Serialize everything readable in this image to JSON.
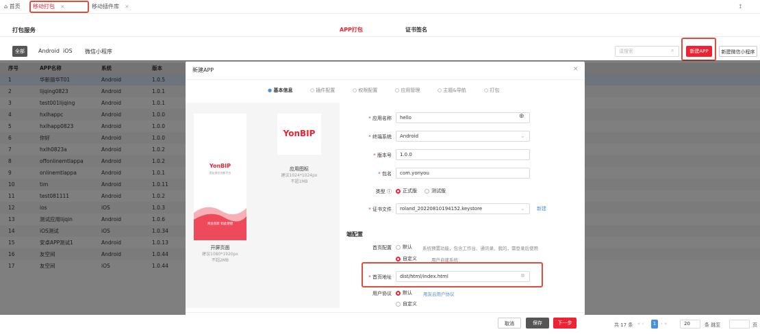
{
  "tabs": [
    {
      "label": "首页",
      "icon": "home-icon"
    },
    {
      "label": "移动打包"
    },
    {
      "label": "移动插件库"
    }
  ],
  "header": {
    "title": "打包服务",
    "nav": [
      "APP打包",
      "证书签名"
    ]
  },
  "filter": {
    "chips": [
      "全部",
      "Android",
      "iOS",
      "微信小程序"
    ],
    "search_placeholder": "请搜索",
    "new_app": "新建APP",
    "new_mini": "新建微信小程序"
  },
  "table": {
    "columns": [
      "序号",
      "APP名称",
      "系统",
      "版本"
    ],
    "rows": [
      [
        "1",
        "华新丽华T01",
        "Android",
        "1.0.5"
      ],
      [
        "2",
        "lijqing0823",
        "Android",
        "1.0.1"
      ],
      [
        "3",
        "test001lijqing",
        "Android",
        "1.0.1"
      ],
      [
        "4",
        "hxlhappc",
        "Android",
        "1.0.0"
      ],
      [
        "5",
        "hxlhapp0823",
        "Android",
        "1.0.0"
      ],
      [
        "6",
        "你好",
        "Android",
        "1.0.0"
      ],
      [
        "7",
        "hxlh0823a",
        "Android",
        "1.0.2"
      ],
      [
        "8",
        "offonlinemtlappa",
        "Android",
        "1.0.2"
      ],
      [
        "9",
        "onlinemtlappa",
        "Android",
        "1.0.1"
      ],
      [
        "10",
        "tim",
        "Android",
        "1.0.11"
      ],
      [
        "11",
        "test081111",
        "Android",
        "1.0.2"
      ],
      [
        "12",
        "ios",
        "iOS",
        "1.0.3"
      ],
      [
        "13",
        "测试应用lijqin",
        "Android",
        "1.0.6"
      ],
      [
        "14",
        "iOS测试",
        "iOS",
        "1.0.34"
      ],
      [
        "15",
        "安卓APP测试1",
        "Android",
        "1.0.13"
      ],
      [
        "16",
        "友空间",
        "Android",
        "1.0.44"
      ],
      [
        "17",
        "友空间",
        "iOS",
        "1.0.44"
      ]
    ]
  },
  "pagination": {
    "total": "共 17 条",
    "page": "1",
    "size": "20",
    "jump": "条 跳至",
    "page_unit": "页"
  },
  "modal": {
    "title": "新建APP",
    "steps": [
      "基本信息",
      "插件配置",
      "权限配置",
      "应用管理",
      "主题&导航",
      "打包"
    ],
    "splash": {
      "brand": "YonBIP",
      "tagline": "用友商业创新平台",
      "banner": "商业创新 如此便捷",
      "title": "开屏页面",
      "hint1": "建议1080*1920px",
      "hint2": "不超2MB"
    },
    "icon": {
      "brand": "YonBIP",
      "title": "应用图标",
      "hint1": "建议1024*1024px",
      "hint2": "不超1MB"
    },
    "form": {
      "app_name_label": "应用名称",
      "app_name": "hello",
      "os_label": "终端系统",
      "os": "Android",
      "version_label": "版本号",
      "version": "1.0.0",
      "package_label": "包名",
      "package": "com.yonyou",
      "type_label": "类型",
      "type_formal": "正式版",
      "type_test": "测试版",
      "cert_label": "证书文件",
      "cert": "roland_20220810194152.keystore",
      "cert_new": "新建",
      "section": "端配置",
      "home_label": "首页配置",
      "home_default": "默认",
      "home_default_desc": "系统预置功能，包含工作台、通讯录、我的，需登录后使用",
      "home_custom": "自定义",
      "home_custom_desc": "用户自建系统",
      "home_url_label": "首页地址",
      "home_url": "dist/html/index.html",
      "protocol_label": "用户协议",
      "protocol_default": "默认",
      "protocol_link": "用友云用户协议",
      "protocol_custom": "自定义"
    },
    "buttons": {
      "cancel": "取消",
      "save": "保存",
      "next": "下一步"
    }
  }
}
